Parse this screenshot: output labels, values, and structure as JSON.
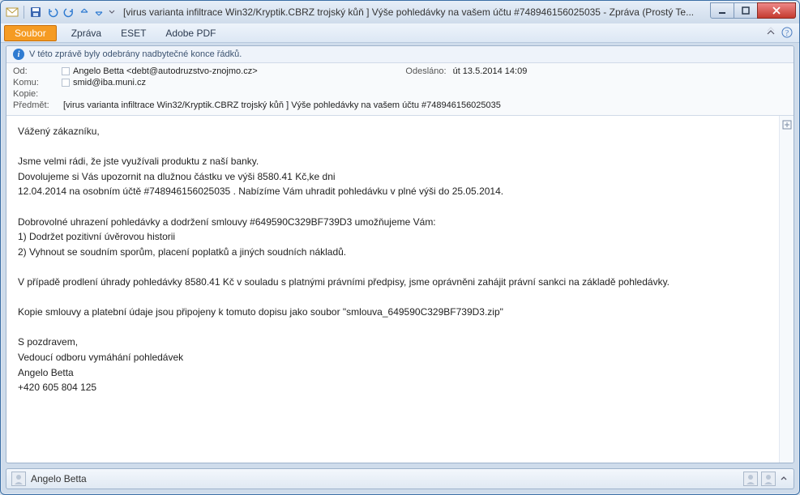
{
  "title": "[virus varianta infiltrace Win32/Kryptik.CBRZ trojský kůň ] Výše pohledávky na vašem účtu #748946156025035  - Zpráva (Prostý Te...",
  "menu": {
    "file": "Soubor",
    "items": [
      "Zpráva",
      "ESET",
      "Adobe PDF"
    ]
  },
  "info_bar": "V této zprávě byly odebrány nadbytečné konce řádků.",
  "headers": {
    "from_label": "Od:",
    "from_value": "Angelo Betta <debt@autodruzstvo-znojmo.cz>",
    "sent_label": "Odesláno:",
    "sent_value": "út 13.5.2014 14:09",
    "to_label": "Komu:",
    "to_value": "smid@iba.muni.cz",
    "cc_label": "Kopie:",
    "cc_value": "",
    "subject_label": "Předmět:",
    "subject_value": "[virus varianta infiltrace Win32/Kryptik.CBRZ trojský kůň ] Výše pohledávky na vašem účtu #748946156025035"
  },
  "body": "Vážený zákazníku,\n\nJsme velmi rádi, že jste využívali produktu z naší banky.\nDovolujeme si Vás upozornit na dlužnou částku ve výši 8580.41 Kč,ke dni\n12.04.2014 na osobním účtě #748946156025035 . Nabízíme Vám uhradit pohledávku v plné výši do 25.05.2014.\n\nDobrovolné uhrazení pohledávky a dodržení smlouvy #649590C329BF739D3 umožňujeme Vám:\n1) Dodržet pozitivní úvěrovou historii\n2) Vyhnout se soudním sporům, placení poplatků a jiných soudních nákladů.\n\nV případě prodlení úhrady pohledávky 8580.41 Kč v souladu s platnými právními předpisy, jsme oprávněni zahájit právní sankci na základě pohledávky.\n\nKopie smlouvy a platební údaje jsou připojeny k tomuto dopisu jako soubor \"smlouva_649590C329BF739D3.zip\"\n\nS pozdravem,\nVedoucí odboru vymáhání pohledávek\nAngelo Betta\n+420 605 804 125",
  "status": {
    "name": "Angelo Betta"
  }
}
